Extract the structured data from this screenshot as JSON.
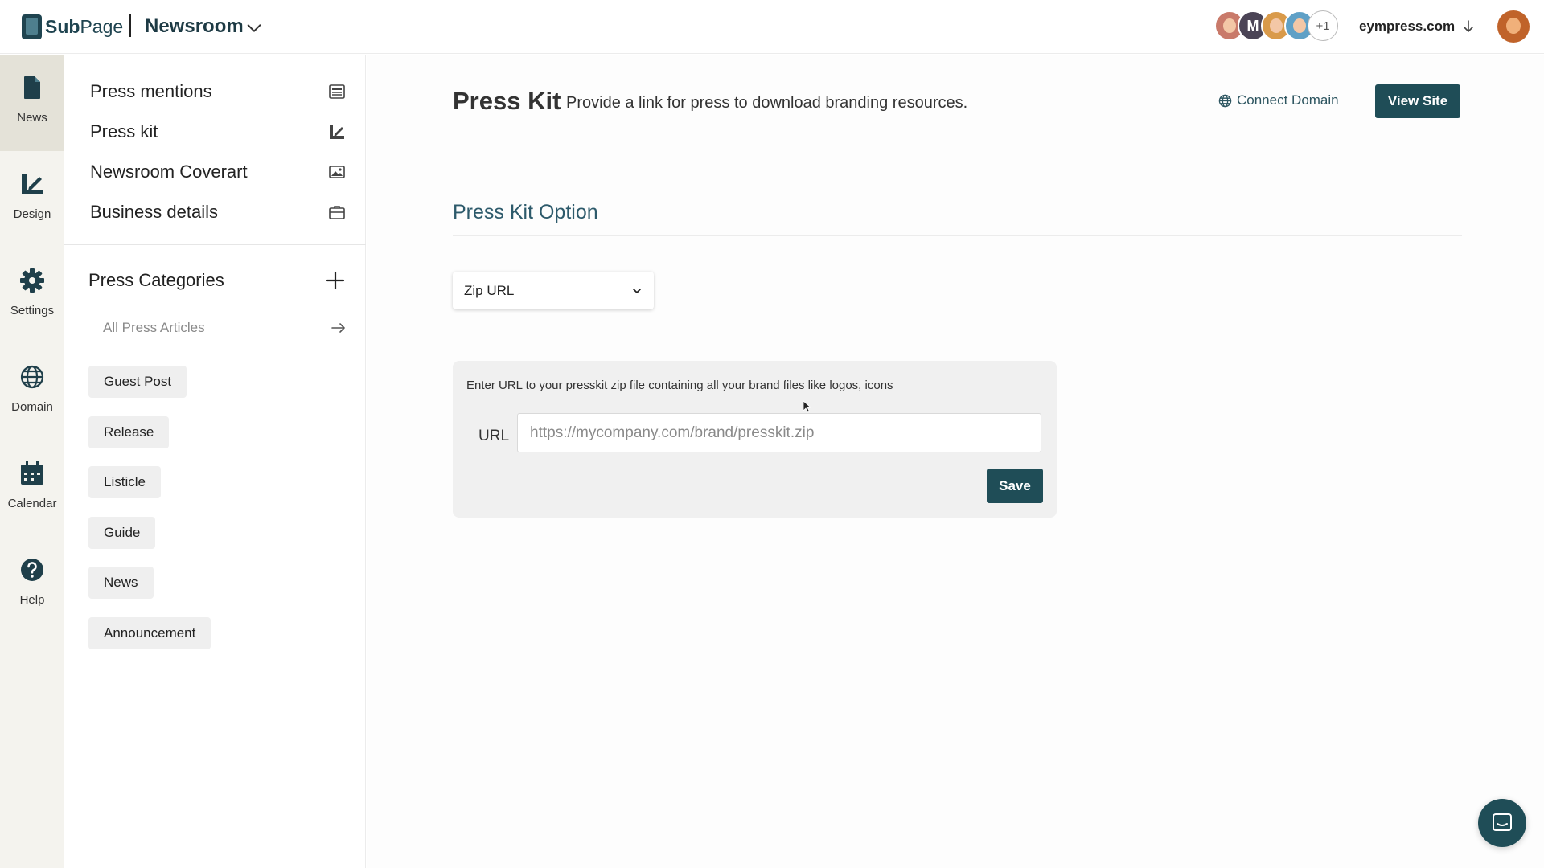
{
  "header": {
    "logo_prefix": "Sub",
    "logo_suffix": "Page",
    "brand": "Newsroom",
    "avatar_more": "+1",
    "avatar_initial": "M",
    "domain": "eympress.com"
  },
  "rail": {
    "items": [
      {
        "label": "News",
        "icon": "document-icon",
        "active": true
      },
      {
        "label": "Design",
        "icon": "design-icon"
      },
      {
        "label": "Settings",
        "icon": "gear-icon"
      },
      {
        "label": "Domain",
        "icon": "globe-icon"
      },
      {
        "label": "Calendar",
        "icon": "calendar-icon"
      },
      {
        "label": "Help",
        "icon": "help-icon"
      }
    ]
  },
  "sidebar": {
    "nav": [
      {
        "label": "Press mentions",
        "icon": "newspaper-icon"
      },
      {
        "label": "Press kit",
        "icon": "press-kit-icon"
      },
      {
        "label": "Newsroom Coverart",
        "icon": "image-icon"
      },
      {
        "label": "Business details",
        "icon": "briefcase-icon"
      }
    ],
    "categories_title": "Press Categories",
    "all_articles": "All Press Articles",
    "categories": [
      "Guest Post",
      "Release",
      "Listicle",
      "Guide",
      "News",
      "Announcement"
    ]
  },
  "main": {
    "title": "Press Kit",
    "subtitle": "Provide a link for press to download branding resources.",
    "connect_domain": "Connect Domain",
    "view_site": "View Site",
    "section_title": "Press Kit Option",
    "option_selected": "Zip URL",
    "panel_hint": "Enter URL to your presskit zip file containing all your brand files like logos, icons",
    "url_label": "URL",
    "url_placeholder": "https://mycompany.com/brand/presskit.zip",
    "save": "Save"
  },
  "colors": {
    "accent": "#1f4d57",
    "section_title": "#2d5a6b",
    "rail_bg": "#f4f3ee",
    "rail_active": "#e4e2d8"
  }
}
